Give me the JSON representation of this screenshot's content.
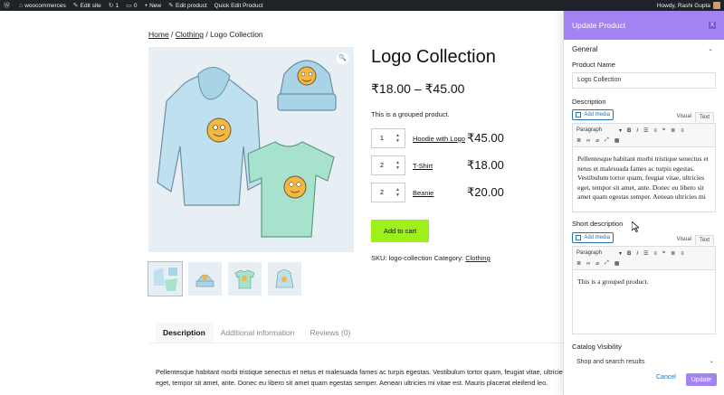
{
  "adminbar": {
    "site": "woocommerces",
    "edit_site": "Edit site",
    "updates": "1",
    "comments": "0",
    "new": "+ New",
    "edit_product": "Edit product",
    "quick_edit": "Quick Edit Product",
    "howdy": "Howdy, Rashi Gupta"
  },
  "breadcrumb": {
    "home": "Home",
    "sep": " / ",
    "category": "Clothing",
    "current": "Logo Collection"
  },
  "product": {
    "title": "Logo Collection",
    "price": "₹18.00 – ₹45.00",
    "short": "This is a grouped product.",
    "items": [
      {
        "qty": "1",
        "name": "Hoodie with Logo",
        "price": "₹45.00"
      },
      {
        "qty": "2",
        "name": "T-Shirt",
        "price": "₹18.00"
      },
      {
        "qty": "2",
        "name": "Beanie",
        "price": "₹20.00"
      }
    ],
    "add_to_cart": "Add to cart",
    "meta_prefix": "SKU: logo-collection Category: ",
    "meta_category": "Clothing"
  },
  "tabs": {
    "description": "Description",
    "additional": "Additional information",
    "reviews": "Reviews (0)"
  },
  "long_description": "Pellentesque habitant morbi tristique senectus et netus et malesuada fames ac turpis egestas. Vestibulum tortor quam, feugiat vitae, ultricies eget, tempor sit amet, ante. Donec eu libero sit amet quam egestas semper. Aenean ultricies mi vitae est. Mauris placerat eleifend leo.",
  "panel": {
    "title": "Update Product",
    "close": "X",
    "section_general": "General",
    "product_name_label": "Product Name",
    "product_name_value": "Logo Collection",
    "description_label": "Description",
    "add_media": "Add media",
    "visual_tab": "Visual",
    "text_tab": "Text",
    "paragraph": "Paragraph",
    "description_body": "Pellentesque habitant morbi tristique senectus et netus et malesuada fames ac turpis egestas. Vestibulum tortor quam, feugiat vitae, ultricies eget, tempor sit amet, ante. Donec eu libero sit amet quam egestas semper. Aenean ultricies mi",
    "short_description_label": "Short description",
    "short_body": "This is a grouped product.",
    "catalog_label": "Catalog Visibility",
    "catalog_value": "Shop and search results",
    "cancel": "Cancel",
    "update": "Update"
  },
  "colors": {
    "accent": "#a383f2",
    "cart": "#9ef01a",
    "adminbar": "#1d2327"
  }
}
